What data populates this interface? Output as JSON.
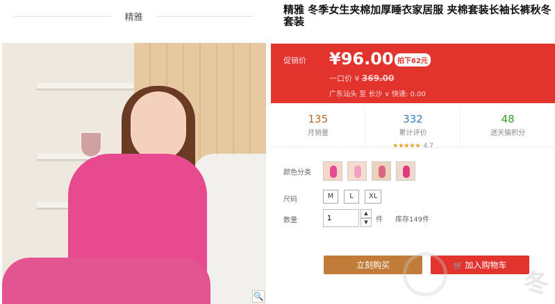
{
  "store": {
    "name": "精雅"
  },
  "product": {
    "title": "精雅 冬季女生夹棉加厚睡衣家居服 夹棉套装长袖长裤秋冬套装"
  },
  "price": {
    "label": "促销价",
    "current": "¥96.00",
    "discount_badge": "拍下62元",
    "original_label": "一口价",
    "original_prefix": "¥",
    "original_value": "369.00",
    "shipping": "广东汕头 至 长沙 ∨ 快递: 0.00"
  },
  "stats": [
    {
      "value": "135",
      "label": "月销量",
      "color": "#b56b24"
    },
    {
      "value": "332",
      "label": "累计评价",
      "color": "#2f7dbc",
      "stars": "★★★★★",
      "score": "4.7"
    },
    {
      "value": "48",
      "label": "送天猫积分",
      "color": "#3b9b2f"
    }
  ],
  "options": {
    "color_label": "颜色分类",
    "size_label": "尺码",
    "sizes": [
      "M",
      "L",
      "XL"
    ],
    "qty_label": "数量",
    "qty_value": "1",
    "unit": "件",
    "stock": "库存149件"
  },
  "actions": {
    "buy": "立刻购买",
    "cart": "加入购物车"
  },
  "icons": {
    "zoom": "magnifier-icon",
    "cart": "cart-icon"
  }
}
